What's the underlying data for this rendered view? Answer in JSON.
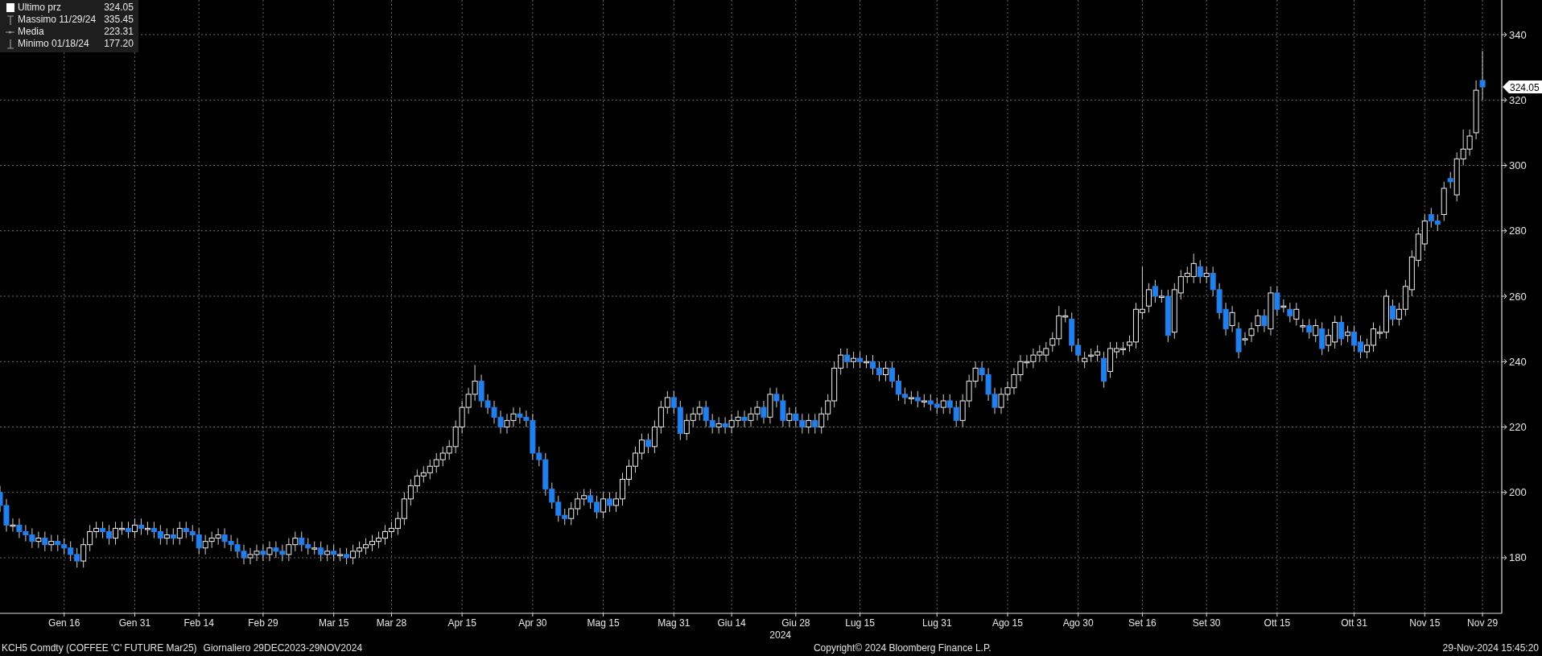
{
  "legend": [
    {
      "kind": "last",
      "label": "Ultimo prz",
      "value": "324.05"
    },
    {
      "kind": "high",
      "label": "Massimo 11/29/24",
      "value": "335.45"
    },
    {
      "kind": "mean",
      "label": "Media",
      "value": "223.31"
    },
    {
      "kind": "low",
      "label": "Minimo 01/18/24",
      "value": "177.20"
    }
  ],
  "price_tag": "324.05",
  "chart_data": {
    "type": "candlestick",
    "grid": true,
    "xlabel": "2024",
    "ylim": [
      163,
      350.6
    ],
    "yticks": [
      180,
      200,
      220,
      240,
      260,
      280,
      300,
      320,
      340
    ],
    "categories": [
      null,
      null,
      null,
      null,
      null,
      null,
      null,
      null,
      null,
      null,
      "Gen 16",
      null,
      null,
      null,
      null,
      null,
      null,
      null,
      null,
      null,
      null,
      "Gen 31",
      null,
      null,
      null,
      null,
      null,
      null,
      null,
      null,
      null,
      "Feb 14",
      null,
      null,
      null,
      null,
      null,
      null,
      null,
      null,
      null,
      "Feb 29",
      null,
      null,
      null,
      null,
      null,
      null,
      null,
      null,
      null,
      null,
      "Mar 15",
      null,
      null,
      null,
      null,
      null,
      null,
      null,
      null,
      "Mar 28",
      null,
      null,
      null,
      null,
      null,
      null,
      null,
      null,
      null,
      null,
      "Apr 15",
      null,
      null,
      null,
      null,
      null,
      null,
      null,
      null,
      null,
      null,
      "Apr 30",
      null,
      null,
      null,
      null,
      null,
      null,
      null,
      null,
      null,
      null,
      "Mag 15",
      null,
      null,
      null,
      null,
      null,
      null,
      null,
      null,
      null,
      null,
      "Mag 31",
      null,
      null,
      null,
      null,
      null,
      null,
      null,
      null,
      "Giu 14",
      null,
      null,
      null,
      null,
      null,
      null,
      null,
      null,
      null,
      "Giu 28",
      null,
      null,
      null,
      null,
      null,
      null,
      null,
      null,
      null,
      "Lug 15",
      null,
      null,
      null,
      null,
      null,
      null,
      null,
      null,
      null,
      null,
      null,
      "Lug 31",
      null,
      null,
      null,
      null,
      null,
      null,
      null,
      null,
      null,
      null,
      "Ago 15",
      null,
      null,
      null,
      null,
      null,
      null,
      null,
      null,
      null,
      null,
      "Ago 30",
      null,
      null,
      null,
      null,
      null,
      null,
      null,
      null,
      null,
      "Set 16",
      null,
      null,
      null,
      null,
      null,
      null,
      null,
      null,
      null,
      "Set 30",
      null,
      null,
      null,
      null,
      null,
      null,
      null,
      null,
      null,
      null,
      "Ott 15",
      null,
      null,
      null,
      null,
      null,
      null,
      null,
      null,
      null,
      null,
      null,
      "Ott 31",
      null,
      null,
      null,
      null,
      null,
      null,
      null,
      null,
      null,
      null,
      "Nov 15",
      null,
      null,
      null,
      null,
      null,
      null,
      null,
      null,
      "Nov 29"
    ],
    "ohlc": [
      [
        200,
        202,
        194,
        196
      ],
      [
        196,
        198,
        188,
        190
      ],
      [
        190,
        192,
        188,
        190
      ],
      [
        190,
        192,
        186,
        188
      ],
      [
        188,
        190,
        185,
        187
      ],
      [
        187,
        189,
        183,
        185
      ],
      [
        185,
        188,
        183,
        186
      ],
      [
        186,
        188,
        182,
        184
      ],
      [
        184,
        187,
        182,
        185
      ],
      [
        185,
        187,
        182,
        184
      ],
      [
        184,
        186,
        181,
        183
      ],
      [
        183,
        185,
        179,
        181
      ],
      [
        181,
        183,
        177,
        179
      ],
      [
        179,
        186,
        177,
        184
      ],
      [
        184,
        190,
        182,
        188
      ],
      [
        188,
        191,
        186,
        189
      ],
      [
        189,
        191,
        186,
        188
      ],
      [
        188,
        190,
        184,
        186
      ],
      [
        186,
        191,
        184,
        189
      ],
      [
        189,
        191,
        187,
        189
      ],
      [
        189,
        191,
        186,
        188
      ],
      [
        188,
        192,
        186,
        190
      ],
      [
        190,
        192,
        187,
        189
      ],
      [
        189,
        191,
        187,
        189
      ],
      [
        189,
        191,
        186,
        188
      ],
      [
        188,
        190,
        184,
        186
      ],
      [
        186,
        189,
        184,
        187
      ],
      [
        187,
        189,
        184,
        186
      ],
      [
        186,
        191,
        184,
        189
      ],
      [
        189,
        191,
        186,
        188
      ],
      [
        188,
        190,
        185,
        187
      ],
      [
        187,
        189,
        181,
        183
      ],
      [
        183,
        187,
        181,
        185
      ],
      [
        185,
        188,
        183,
        186
      ],
      [
        186,
        189,
        184,
        187
      ],
      [
        187,
        189,
        183,
        185
      ],
      [
        185,
        187,
        182,
        184
      ],
      [
        184,
        186,
        180,
        182
      ],
      [
        182,
        184,
        178,
        180
      ],
      [
        180,
        183,
        178,
        181
      ],
      [
        181,
        184,
        179,
        182
      ],
      [
        182,
        184,
        179,
        181
      ],
      [
        181,
        185,
        179,
        183
      ],
      [
        183,
        185,
        180,
        182
      ],
      [
        182,
        184,
        179,
        181
      ],
      [
        181,
        186,
        179,
        184
      ],
      [
        184,
        188,
        182,
        186
      ],
      [
        186,
        188,
        182,
        184
      ],
      [
        184,
        186,
        181,
        183
      ],
      [
        183,
        185,
        181,
        183
      ],
      [
        183,
        185,
        179,
        181
      ],
      [
        181,
        184,
        179,
        182
      ],
      [
        182,
        184,
        179,
        181
      ],
      [
        181,
        183,
        179,
        181
      ],
      [
        181,
        183,
        178,
        180
      ],
      [
        180,
        184,
        178,
        182
      ],
      [
        182,
        185,
        180,
        183
      ],
      [
        183,
        186,
        181,
        184
      ],
      [
        184,
        187,
        182,
        185
      ],
      [
        185,
        188,
        183,
        186
      ],
      [
        186,
        190,
        184,
        188
      ],
      [
        188,
        191,
        186,
        189
      ],
      [
        189,
        194,
        187,
        192
      ],
      [
        192,
        200,
        190,
        198
      ],
      [
        198,
        204,
        196,
        202
      ],
      [
        202,
        207,
        200,
        205
      ],
      [
        205,
        208,
        203,
        206
      ],
      [
        206,
        210,
        204,
        208
      ],
      [
        208,
        212,
        206,
        210
      ],
      [
        210,
        214,
        208,
        212
      ],
      [
        212,
        216,
        210,
        214
      ],
      [
        214,
        222,
        212,
        220
      ],
      [
        220,
        228,
        218,
        226
      ],
      [
        226,
        232,
        224,
        230
      ],
      [
        230,
        239,
        228,
        234
      ],
      [
        234,
        236,
        226,
        228
      ],
      [
        228,
        230,
        224,
        226
      ],
      [
        226,
        228,
        221,
        223
      ],
      [
        223,
        225,
        218,
        220
      ],
      [
        220,
        224,
        218,
        222
      ],
      [
        222,
        226,
        220,
        224
      ],
      [
        224,
        226,
        221,
        223
      ],
      [
        223,
        225,
        220,
        222
      ],
      [
        222,
        224,
        210,
        212
      ],
      [
        212,
        214,
        208,
        210
      ],
      [
        210,
        212,
        199,
        201
      ],
      [
        201,
        203,
        195,
        197
      ],
      [
        197,
        199,
        191,
        193
      ],
      [
        193,
        195,
        190,
        192
      ],
      [
        192,
        197,
        190,
        195
      ],
      [
        195,
        200,
        193,
        198
      ],
      [
        198,
        201,
        196,
        199
      ],
      [
        199,
        201,
        195,
        197
      ],
      [
        197,
        199,
        192,
        194
      ],
      [
        194,
        200,
        192,
        198
      ],
      [
        198,
        200,
        194,
        196
      ],
      [
        196,
        200,
        194,
        198
      ],
      [
        198,
        206,
        196,
        204
      ],
      [
        204,
        210,
        202,
        208
      ],
      [
        208,
        214,
        206,
        212
      ],
      [
        212,
        218,
        210,
        216
      ],
      [
        216,
        218,
        212,
        214
      ],
      [
        214,
        222,
        212,
        220
      ],
      [
        220,
        228,
        218,
        226
      ],
      [
        226,
        231,
        224,
        229
      ],
      [
        229,
        231,
        224,
        226
      ],
      [
        226,
        228,
        216,
        218
      ],
      [
        218,
        224,
        216,
        222
      ],
      [
        222,
        226,
        220,
        224
      ],
      [
        224,
        228,
        222,
        226
      ],
      [
        226,
        228,
        220,
        222
      ],
      [
        222,
        224,
        218,
        220
      ],
      [
        220,
        223,
        218,
        221
      ],
      [
        221,
        223,
        218,
        220
      ],
      [
        220,
        224,
        218,
        222
      ],
      [
        222,
        225,
        220,
        223
      ],
      [
        223,
        225,
        220,
        222
      ],
      [
        222,
        226,
        220,
        224
      ],
      [
        224,
        228,
        222,
        226
      ],
      [
        226,
        228,
        221,
        223
      ],
      [
        223,
        232,
        221,
        230
      ],
      [
        230,
        232,
        226,
        228
      ],
      [
        228,
        230,
        220,
        222
      ],
      [
        222,
        226,
        220,
        224
      ],
      [
        224,
        226,
        220,
        222
      ],
      [
        222,
        224,
        218,
        220
      ],
      [
        220,
        224,
        218,
        222
      ],
      [
        222,
        224,
        218,
        220
      ],
      [
        220,
        226,
        218,
        224
      ],
      [
        224,
        230,
        222,
        228
      ],
      [
        228,
        240,
        226,
        238
      ],
      [
        238,
        244,
        236,
        242
      ],
      [
        242,
        244,
        238,
        240
      ],
      [
        240,
        243,
        238,
        241
      ],
      [
        241,
        243,
        238,
        240
      ],
      [
        240,
        242,
        238,
        240
      ],
      [
        240,
        242,
        236,
        238
      ],
      [
        238,
        240,
        234,
        236
      ],
      [
        236,
        240,
        234,
        238
      ],
      [
        238,
        240,
        232,
        234
      ],
      [
        234,
        236,
        228,
        230
      ],
      [
        230,
        232,
        227,
        229
      ],
      [
        229,
        231,
        227,
        229
      ],
      [
        229,
        231,
        226,
        228
      ],
      [
        228,
        230,
        226,
        228
      ],
      [
        228,
        230,
        225,
        227
      ],
      [
        227,
        229,
        224,
        226
      ],
      [
        226,
        230,
        224,
        228
      ],
      [
        228,
        230,
        224,
        226
      ],
      [
        226,
        228,
        220,
        222
      ],
      [
        222,
        230,
        220,
        228
      ],
      [
        228,
        236,
        226,
        234
      ],
      [
        234,
        240,
        232,
        238
      ],
      [
        238,
        240,
        234,
        236
      ],
      [
        236,
        238,
        228,
        230
      ],
      [
        230,
        232,
        224,
        226
      ],
      [
        226,
        232,
        224,
        230
      ],
      [
        230,
        234,
        228,
        232
      ],
      [
        232,
        238,
        230,
        236
      ],
      [
        236,
        242,
        234,
        240
      ],
      [
        240,
        242,
        238,
        240
      ],
      [
        240,
        244,
        238,
        242
      ],
      [
        242,
        245,
        240,
        243
      ],
      [
        242,
        246,
        240,
        244
      ],
      [
        245,
        249,
        243,
        247
      ],
      [
        247,
        257,
        245,
        254
      ],
      [
        254,
        256,
        252,
        254
      ],
      [
        253,
        255,
        243,
        245
      ],
      [
        245,
        247,
        240,
        242
      ],
      [
        240,
        243,
        238,
        241
      ],
      [
        242,
        244,
        240,
        242
      ],
      [
        242,
        245,
        240,
        243
      ],
      [
        241,
        243,
        232,
        234
      ],
      [
        237,
        246,
        235,
        244
      ],
      [
        243,
        246,
        241,
        244
      ],
      [
        244,
        246,
        242,
        244
      ],
      [
        245,
        248,
        243,
        246
      ],
      [
        246,
        258,
        244,
        256
      ],
      [
        255,
        269,
        253,
        256
      ],
      [
        257,
        264,
        255,
        262
      ],
      [
        263,
        265,
        258,
        260
      ],
      [
        260,
        262,
        258,
        260
      ],
      [
        260,
        262,
        246,
        248
      ],
      [
        249,
        264,
        247,
        262
      ],
      [
        261,
        268,
        259,
        266
      ],
      [
        266,
        269,
        264,
        267
      ],
      [
        266,
        273,
        264,
        270
      ],
      [
        269,
        271,
        264,
        266
      ],
      [
        266,
        269,
        264,
        267
      ],
      [
        267,
        269,
        260,
        262
      ],
      [
        262,
        264,
        253,
        255
      ],
      [
        256,
        258,
        248,
        250
      ],
      [
        251,
        257,
        249,
        255
      ],
      [
        250,
        252,
        241,
        243
      ],
      [
        247,
        249,
        245,
        247
      ],
      [
        248,
        252,
        246,
        250
      ],
      [
        251,
        256,
        249,
        254
      ],
      [
        254,
        256,
        249,
        251
      ],
      [
        250,
        263,
        248,
        261
      ],
      [
        261,
        263,
        254,
        256
      ],
      [
        257,
        259,
        255,
        257
      ],
      [
        256,
        258,
        252,
        254
      ],
      [
        253,
        258,
        251,
        256
      ],
      [
        251,
        253,
        249,
        251
      ],
      [
        251,
        253,
        247,
        249
      ],
      [
        248,
        253,
        246,
        251
      ],
      [
        250,
        252,
        242,
        244
      ],
      [
        245,
        250,
        243,
        248
      ],
      [
        246,
        254,
        244,
        252
      ],
      [
        252,
        254,
        245,
        247
      ],
      [
        248,
        251,
        246,
        249
      ],
      [
        249,
        251,
        243,
        245
      ],
      [
        246,
        248,
        241,
        243
      ],
      [
        243,
        247,
        241,
        245
      ],
      [
        245,
        252,
        243,
        250
      ],
      [
        249,
        251,
        247,
        249
      ],
      [
        249,
        262,
        247,
        260
      ],
      [
        257,
        259,
        251,
        253
      ],
      [
        253,
        258,
        251,
        256
      ],
      [
        256,
        265,
        254,
        263
      ],
      [
        262,
        274,
        260,
        272
      ],
      [
        271,
        281,
        269,
        279
      ],
      [
        276,
        285,
        274,
        283
      ],
      [
        285,
        287,
        281,
        283
      ],
      [
        283,
        285,
        280,
        282
      ],
      [
        285,
        295,
        283,
        293
      ],
      [
        296,
        298,
        293,
        295
      ],
      [
        291,
        304,
        289,
        302
      ],
      [
        302,
        311,
        300,
        305
      ],
      [
        305,
        311,
        303,
        309
      ],
      [
        310,
        326,
        308,
        323
      ],
      [
        326,
        335,
        320,
        324
      ]
    ]
  },
  "status_bar": {
    "instrument": "KCH5 Comdty (COFFEE 'C' FUTURE Mar25)",
    "period": "Giornaliero 29DEC2023-29NOV2024",
    "copyright": "Copyright© 2024 Bloomberg Finance L.P.",
    "timestamp": "29-Nov-2024 15:45:20"
  }
}
